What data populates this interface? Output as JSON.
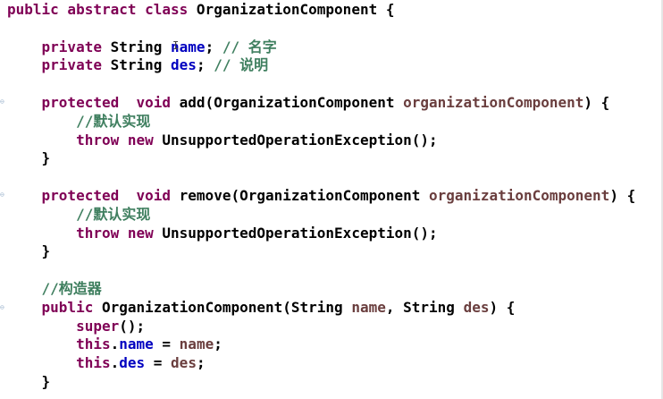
{
  "editor": {
    "lines": [
      {
        "segments": [
          {
            "text": "public abstract class ",
            "cls": "kw"
          },
          {
            "text": "OrganizationComponent {",
            "cls": "plain"
          }
        ]
      },
      {
        "segments": []
      },
      {
        "segments": [
          {
            "text": "    private ",
            "cls": "kw"
          },
          {
            "text": "String ",
            "cls": "plain"
          },
          {
            "text": "name",
            "cls": "field"
          },
          {
            "text": "; ",
            "cls": "plain"
          },
          {
            "text": "// 名字",
            "cls": "comment"
          }
        ]
      },
      {
        "segments": [
          {
            "text": "    private ",
            "cls": "kw"
          },
          {
            "text": "String ",
            "cls": "plain"
          },
          {
            "text": "des",
            "cls": "field"
          },
          {
            "text": "; ",
            "cls": "plain"
          },
          {
            "text": "// 说明",
            "cls": "comment"
          }
        ]
      },
      {
        "segments": []
      },
      {
        "segments": [
          {
            "text": "    protected  void ",
            "cls": "kw"
          },
          {
            "text": "add(OrganizationComponent ",
            "cls": "plain"
          },
          {
            "text": "organizationComponent",
            "cls": "param"
          },
          {
            "text": ") {",
            "cls": "plain"
          }
        ]
      },
      {
        "segments": [
          {
            "text": "        //默认实现",
            "cls": "comment"
          }
        ]
      },
      {
        "segments": [
          {
            "text": "        throw new ",
            "cls": "kw"
          },
          {
            "text": "UnsupportedOperationException();",
            "cls": "plain"
          }
        ]
      },
      {
        "segments": [
          {
            "text": "    }",
            "cls": "plain"
          }
        ]
      },
      {
        "segments": []
      },
      {
        "segments": [
          {
            "text": "    protected  void ",
            "cls": "kw"
          },
          {
            "text": "remove(OrganizationComponent ",
            "cls": "plain"
          },
          {
            "text": "organizationComponent",
            "cls": "param"
          },
          {
            "text": ") {",
            "cls": "plain"
          }
        ]
      },
      {
        "segments": [
          {
            "text": "        //默认实现",
            "cls": "comment"
          }
        ]
      },
      {
        "segments": [
          {
            "text": "        throw new ",
            "cls": "kw"
          },
          {
            "text": "UnsupportedOperationException();",
            "cls": "plain"
          }
        ]
      },
      {
        "segments": [
          {
            "text": "    }",
            "cls": "plain"
          }
        ]
      },
      {
        "segments": []
      },
      {
        "segments": [
          {
            "text": "    //构造器",
            "cls": "comment"
          }
        ]
      },
      {
        "segments": [
          {
            "text": "    public ",
            "cls": "kw"
          },
          {
            "text": "OrganizationComponent(String ",
            "cls": "plain"
          },
          {
            "text": "name",
            "cls": "param"
          },
          {
            "text": ", String ",
            "cls": "plain"
          },
          {
            "text": "des",
            "cls": "param"
          },
          {
            "text": ") {",
            "cls": "plain"
          }
        ]
      },
      {
        "segments": [
          {
            "text": "        super",
            "cls": "kw"
          },
          {
            "text": "();",
            "cls": "plain"
          }
        ]
      },
      {
        "segments": [
          {
            "text": "        this",
            "cls": "kw"
          },
          {
            "text": ".",
            "cls": "plain"
          },
          {
            "text": "name",
            "cls": "field"
          },
          {
            "text": " = ",
            "cls": "plain"
          },
          {
            "text": "name",
            "cls": "param"
          },
          {
            "text": ";",
            "cls": "plain"
          }
        ]
      },
      {
        "segments": [
          {
            "text": "        this",
            "cls": "kw"
          },
          {
            "text": ".",
            "cls": "plain"
          },
          {
            "text": "des",
            "cls": "field"
          },
          {
            "text": " = ",
            "cls": "plain"
          },
          {
            "text": "des",
            "cls": "param"
          },
          {
            "text": ";",
            "cls": "plain"
          }
        ]
      },
      {
        "segments": [
          {
            "text": "    }",
            "cls": "plain"
          }
        ]
      }
    ]
  },
  "colors": {
    "keyword": "#7f0055",
    "field": "#0000c0",
    "parameter": "#6a3e3e",
    "comment": "#3f7f5f",
    "text": "#000000"
  },
  "icons": {
    "fold_marker": "collapse-marker-icon",
    "text_cursor": "i-beam-cursor-icon"
  }
}
